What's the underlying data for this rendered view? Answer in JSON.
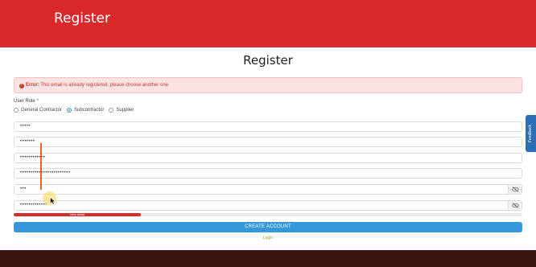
{
  "header": {
    "brand_title": "Register"
  },
  "page": {
    "title": "Register"
  },
  "alert": {
    "icon": "error-circle-icon",
    "label": "Error:",
    "message": " This email is already registered, please choose another one."
  },
  "form": {
    "role_label": "User Role",
    "required_mark": "*",
    "roles": [
      {
        "label": "General Contractor",
        "selected": false
      },
      {
        "label": "Subcontractor",
        "selected": true
      },
      {
        "label": "Supplier",
        "selected": false
      }
    ],
    "fields": [
      {
        "value": "•••••"
      },
      {
        "value": "•••••••"
      },
      {
        "value": "••••••••••••"
      },
      {
        "value": "••••••••••••••••••••••••"
      },
      {
        "value": "•••",
        "toggle_icon": "eye-slash-icon"
      },
      {
        "value": "•••••••••••••",
        "toggle_icon": "eye-slash-icon"
      }
    ],
    "strength": {
      "label": "Very weak",
      "level": 0.25,
      "color": "#d9292b"
    },
    "submit_label": "CREATE ACCOUNT",
    "login_link": "Login"
  },
  "feedback": {
    "label": "Feedback",
    "icon": "feedback-icon"
  },
  "colors": {
    "header": "#d9292b",
    "primary": "#3498db",
    "footer": "#3a140f",
    "feedback": "#2d6fb6"
  }
}
